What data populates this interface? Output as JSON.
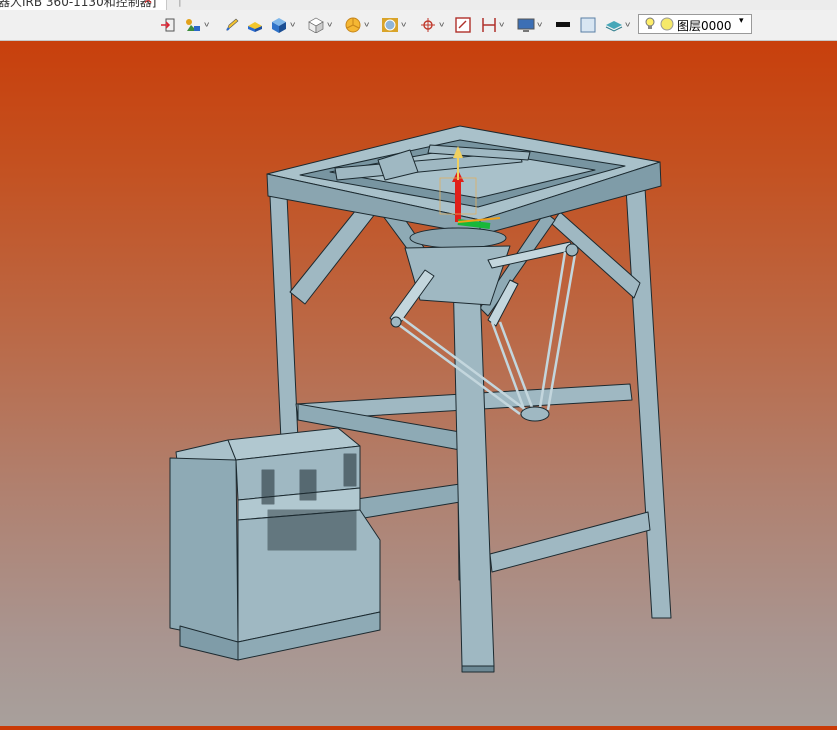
{
  "tab": {
    "title": "器人IRB 360-1130和控制器]",
    "close": "✕",
    "separator": "|"
  },
  "toolbar": {
    "buttons": [
      "exit-icon",
      "move-icon",
      "pencil-icon",
      "box-yellow-icon",
      "cube-blue-icon",
      "cube-white-icon",
      "pie-icon",
      "view-icon",
      "snap-icon",
      "box-red-icon",
      "bracket-icon",
      "monitor-icon",
      "color-black-icon",
      "color-light-icon",
      "layer-stack-icon"
    ],
    "layer_name": "图层0000",
    "layer_arrow": "▾"
  },
  "colors": {
    "bg_top": "#c93a06",
    "bg_bottom": "#a8a09c",
    "model": "#9fb8c2",
    "model_shade": "#7f9ca8",
    "edge": "#1c2a30"
  }
}
